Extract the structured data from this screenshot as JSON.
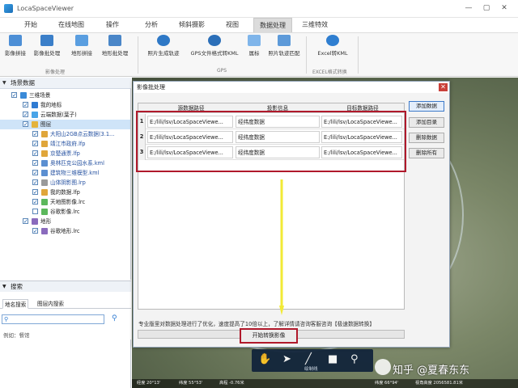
{
  "app": {
    "title": "LocaSpaceViewer"
  },
  "window_controls": {
    "minimize": "—",
    "maximize": "▢",
    "close": "✕"
  },
  "menu": [
    "开始",
    "在线地图",
    "操作",
    "分析",
    "倾斜摄影",
    "视图",
    "数据处理",
    "三维特效"
  ],
  "menu_active_index": 6,
  "ribbon": {
    "buttons": [
      "影像拼接",
      "影像批处理",
      "地形拼接",
      "地形批处理",
      "照片生成轨迹",
      "GPS文件格式转KML",
      "属标",
      "照片轨迹匹配",
      "Excel转KML"
    ],
    "groups": [
      "影像处理",
      "GPS",
      "EXCEL格式转换"
    ]
  },
  "left_panel": {
    "title": "场景数据",
    "tree": [
      {
        "label": "三维场景",
        "checked": true,
        "icon_color": "#3a8ad8"
      },
      {
        "label": "我的地标",
        "checked": true,
        "icon_color": "#2f7bd2"
      },
      {
        "label": "云端数据(葉子)",
        "checked": true,
        "icon_color": "#48a4e8"
      },
      {
        "label": "图层",
        "checked": true,
        "icon_color": "#e3b33c"
      },
      {
        "label": "大阳山2GB点云数据(3.1...",
        "checked": true,
        "icon_color": "#e0a63a"
      },
      {
        "label": "靖江市政府.lfp",
        "checked": true,
        "icon_color": "#e0a63a"
      },
      {
        "label": "京楚通票.lfp",
        "checked": true,
        "icon_color": "#e0a63a"
      },
      {
        "label": "奥林匹克公园水系.kml",
        "checked": true,
        "icon_color": "#5b8fd1"
      },
      {
        "label": "建筑物三维模型.kml",
        "checked": true,
        "icon_color": "#5b8fd1"
      },
      {
        "label": "山体阴影图.lrp",
        "checked": true,
        "icon_color": "#9a9a9a"
      },
      {
        "label": "我的数据.lfp",
        "checked": true,
        "icon_color": "#e0a63a"
      },
      {
        "label": "天地图影像.lrc",
        "checked": true,
        "icon_color": "#5cb85c"
      },
      {
        "label": "谷歌影像.lrc",
        "checked": false,
        "icon_color": "#5cb85c"
      },
      {
        "label": "地形",
        "checked": true,
        "icon_color": "#8a6bbd"
      },
      {
        "label": "谷歌地形.lrc",
        "checked": true,
        "icon_color": "#8a6bbd"
      }
    ],
    "search": {
      "title": "搜索",
      "tabs": [
        "地名搜索",
        "图层内搜索"
      ],
      "placeholder": "",
      "example": "例如：餐馆"
    }
  },
  "dialog": {
    "title": "影像批处理",
    "close": "✕",
    "columns": [
      "源数据路径",
      "投影信息",
      "目标数据路径"
    ],
    "rows": [
      {
        "num": "1",
        "source": "E:/lili/lsv/LocaSpaceViewe...",
        "projection": "经纬度数据",
        "target": "E:/lili/lsv/LocaSpaceViewe..."
      },
      {
        "num": "2",
        "source": "E:/lili/lsv/LocaSpaceViewe...",
        "projection": "经纬度数据",
        "target": "E:/lili/lsv/LocaSpaceViewe..."
      },
      {
        "num": "3",
        "source": "E:/lili/lsv/LocaSpaceViewe...",
        "projection": "经纬度数据",
        "target": "E:/lili/lsv/LocaSpaceViewe..."
      }
    ],
    "side_buttons": [
      "添加数据",
      "添加目录",
      "删除数据",
      "删除所有"
    ],
    "note": "专业版里对数据处理进行了优化，速度提高了10倍以上，了解详情请咨询客服咨询【极速数据转换】",
    "start_button": "开始转换影像"
  },
  "map": {
    "toolbar_label": "绘制线",
    "status": [
      "经度 20°13'",
      "纬度 55°53'",
      "高程 -0.76米",
      "视角高度 2056581.81米",
      "纬度 66°94'"
    ]
  },
  "watermark": "知乎 @夏春东东"
}
